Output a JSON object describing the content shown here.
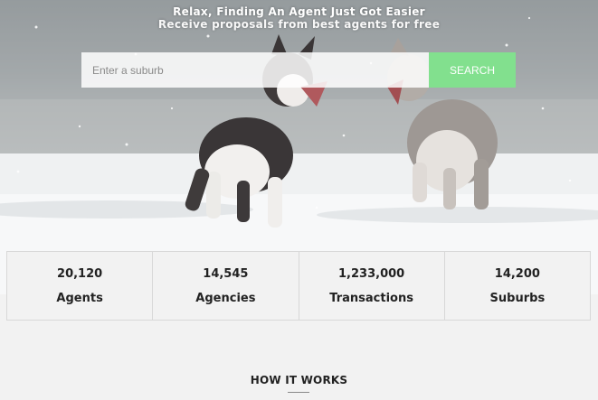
{
  "hero": {
    "tagline": "Relax, Finding An Agent Just Got Easier",
    "subtitle": "Receive proposals from best agents for free",
    "image": "two-husky-dogs-in-snow"
  },
  "search": {
    "placeholder": "Enter a suburb",
    "value": "",
    "button_label": "SEARCH",
    "button_color": "#82e08e"
  },
  "stats": [
    {
      "value": "20,120",
      "label": "Agents"
    },
    {
      "value": "14,545",
      "label": "Agencies"
    },
    {
      "value": "1,233,000",
      "label": "Transactions"
    },
    {
      "value": "14,200",
      "label": "Suburbs"
    }
  ],
  "how_it_works": {
    "title": "HOW IT WORKS"
  }
}
